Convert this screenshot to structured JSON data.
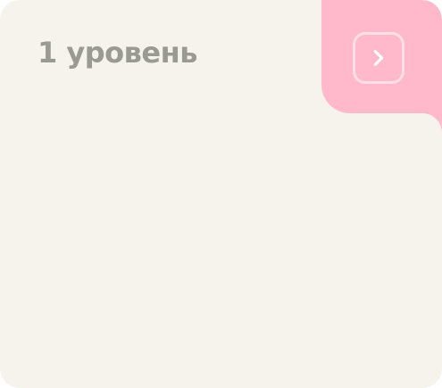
{
  "card": {
    "title": "1 уровень",
    "next_icon": "chevron-right-icon",
    "colors": {
      "background": "#f5f3ec",
      "accent": "#ffb9cb",
      "title_text": "#9a9a92",
      "icon": "#ffffff"
    }
  }
}
